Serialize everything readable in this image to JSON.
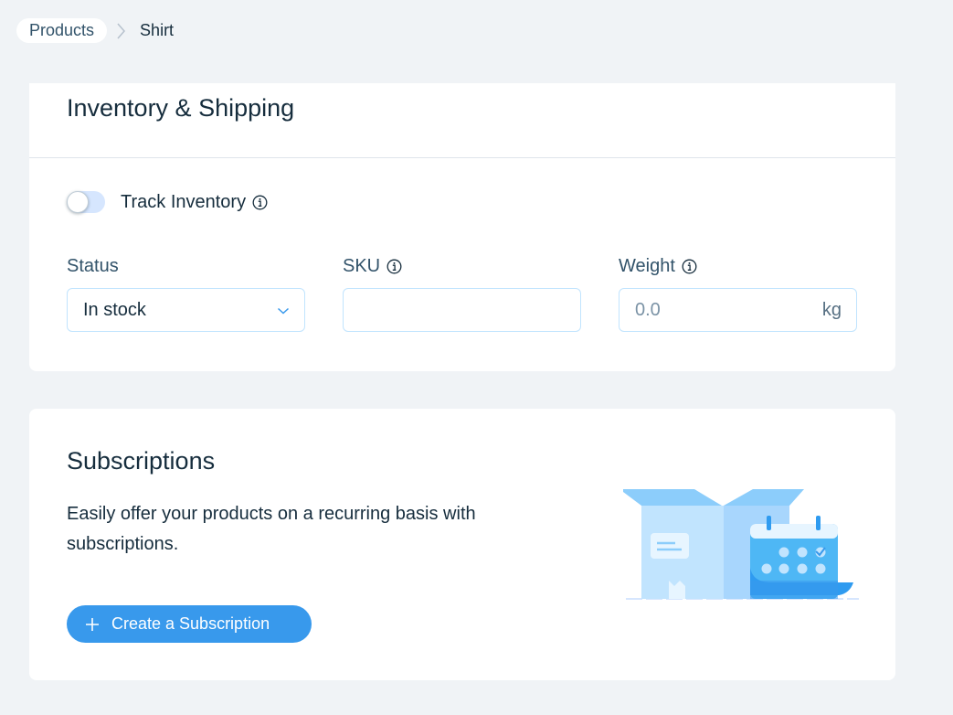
{
  "breadcrumb": {
    "parent": "Products",
    "current": "Shirt",
    "separator_icon": "chevron-right-icon"
  },
  "inventory": {
    "title": "Inventory & Shipping",
    "track_inventory_label": "Track Inventory",
    "track_inventory_enabled": false,
    "fields": {
      "status": {
        "label": "Status",
        "value": "In stock"
      },
      "sku": {
        "label": "SKU",
        "value": ""
      },
      "weight": {
        "label": "Weight",
        "placeholder": "0.0",
        "unit": "kg"
      }
    }
  },
  "subscriptions": {
    "title": "Subscriptions",
    "description": "Easily offer your products on a recurring basis with subscriptions.",
    "button_label": "Create a Subscription",
    "illustration": "box-calendar-illustration"
  },
  "colors": {
    "page_background": "#f0f3f6",
    "accent": "#3899ec",
    "text_primary": "#162d3d",
    "input_border": "#c1e4fe",
    "toggle_track": "#d6e6fe"
  }
}
